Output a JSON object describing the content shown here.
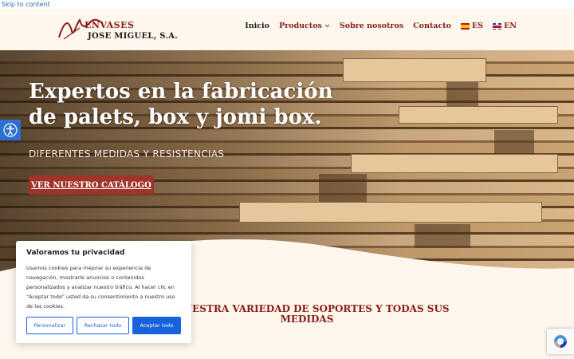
{
  "skip_link": "Skip to content",
  "logo": {
    "line1": "ENVASES",
    "line2": "JOSE MIGUEL, S.A."
  },
  "nav": {
    "items": [
      {
        "label": "Inicio",
        "active": true
      },
      {
        "label": "Productos",
        "has_dropdown": true
      },
      {
        "label": "Sobre nosotros"
      },
      {
        "label": "Contacto"
      },
      {
        "label": "ES",
        "flag": "es-flag-icon"
      },
      {
        "label": "EN",
        "flag": "gb-flag-icon"
      }
    ]
  },
  "hero": {
    "title": "Expertos en la fabricación de palets, box y jomi box.",
    "subtitle": "DIFERENTES MEDIDAS Y RESISTENCIAS",
    "cta": "VER NUESTRO CATÁLOGO"
  },
  "section": {
    "heading": "E NUESTRA VARIEDAD DE SOPORTES Y TODAS SUS MEDIDAS"
  },
  "cookie": {
    "title": "Valoramos tu privacidad",
    "body": "Usamos cookies para mejorar su experiencia de navegación, mostrarle anuncios o contenidos personalizados y analizar nuestro tráfico. Al hacer clic en \"Aceptar todo\" usted da su consentimiento a nuestro uso de las cookies.",
    "btn_customize": "Personalizar",
    "btn_reject": "Rechazar todo",
    "btn_accept": "Aceptar todo"
  },
  "colors": {
    "brand": "#8b1c18",
    "cta": "#a1342a",
    "header_bg": "#fdf7ee",
    "cookie_accent": "#1863dc",
    "accessibility": "#2f6fd1"
  },
  "icons": {
    "accessibility": "accessibility-icon",
    "recaptcha": "recaptcha-icon",
    "dropdown": "chevron-down-icon"
  }
}
